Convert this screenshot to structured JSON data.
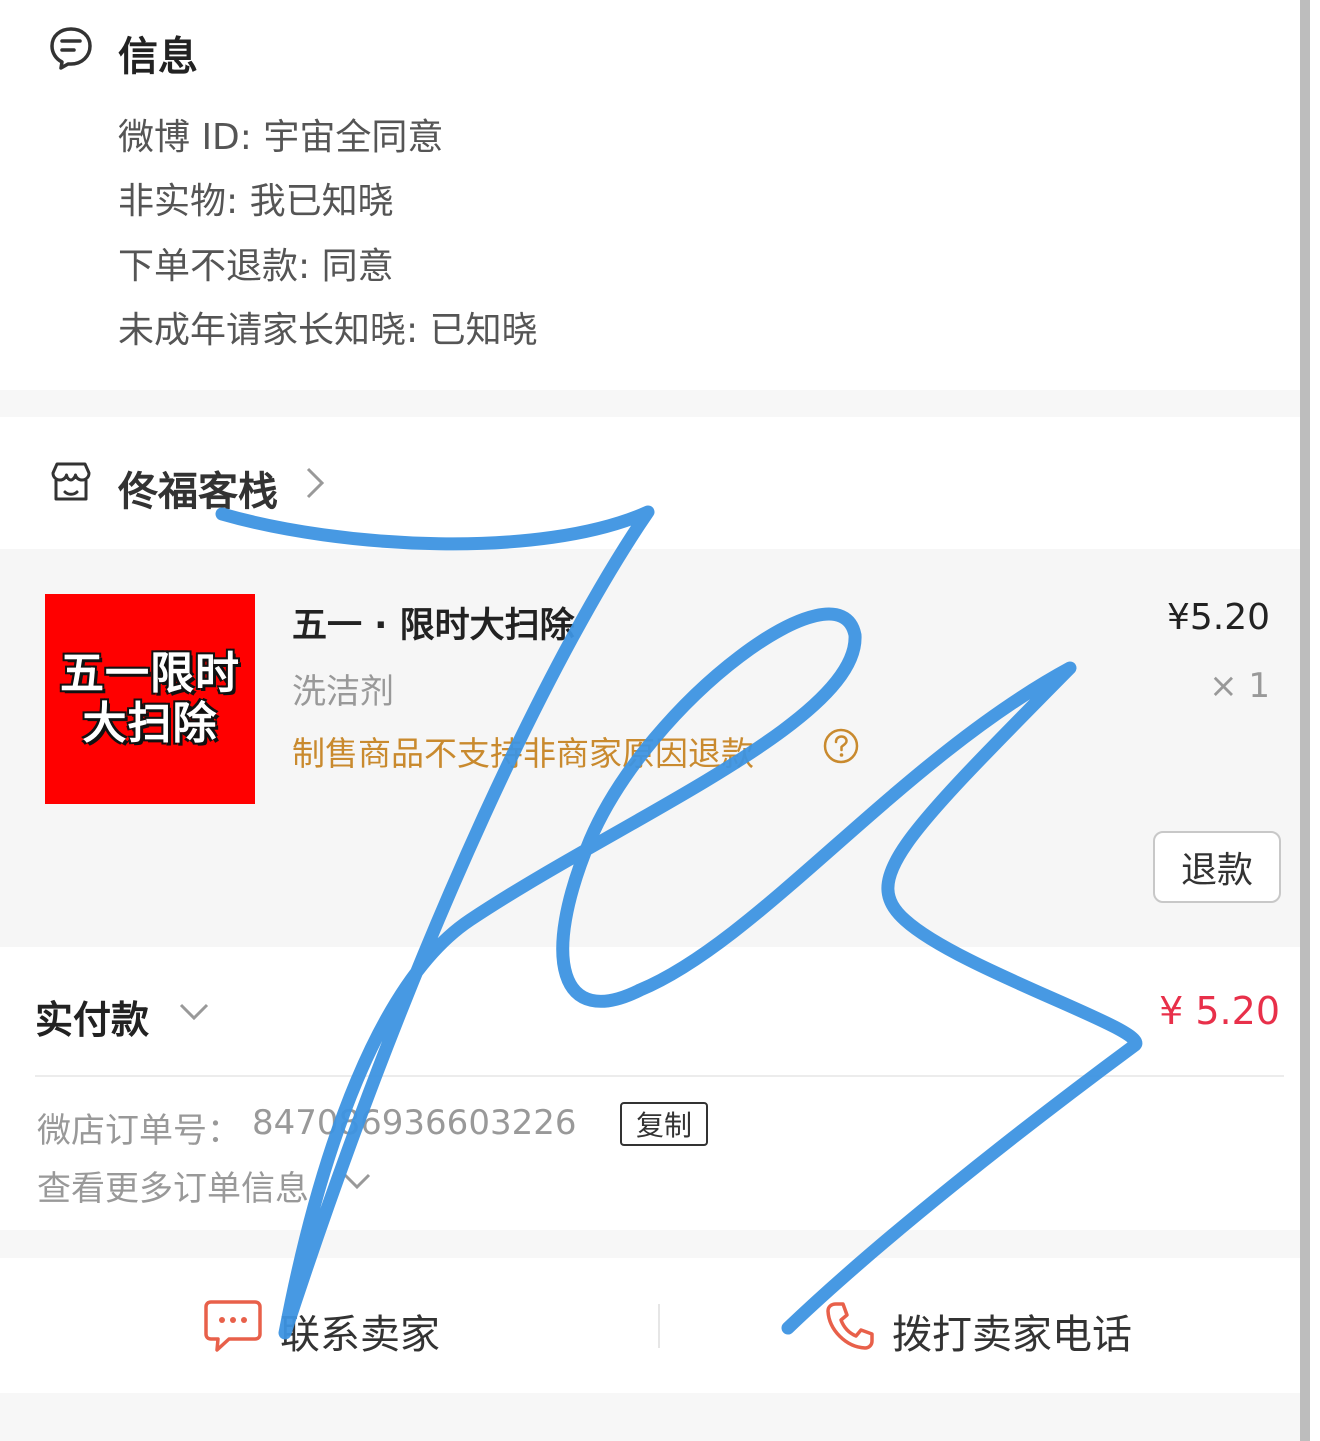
{
  "info": {
    "title": "信息",
    "rows": [
      "微博 ID: 宇宙全同意",
      "非实物: 我已知晓",
      "下单不退款: 同意",
      "未成年请家长知晓: 已知晓"
    ]
  },
  "shop": {
    "name": "佟福客栈"
  },
  "product": {
    "thumbnail_lines": [
      "五一限时",
      "大扫除"
    ],
    "title": "五一 · 限时大扫除",
    "spec": "洗洁剂",
    "notice": "制售商品不支持非商家原因退款",
    "price": "¥5.20",
    "quantity": "× 1",
    "refund_label": "退款"
  },
  "payment": {
    "label": "实付款",
    "amount": "¥ 5.20",
    "order_no_label": "微店订单号：",
    "order_no": "847086936603226",
    "copy_label": "复制",
    "more_label": "查看更多订单信息"
  },
  "actions": {
    "contact_seller": "联系卖家",
    "call_seller": "拨打卖家电话"
  },
  "colors": {
    "price_red": "#e8304a",
    "notice_orange": "#c98a2e",
    "signature_blue": "#3d94e2",
    "thumb_red": "#ff0000"
  },
  "icons": [
    "message-icon",
    "store-icon",
    "chevron-right-icon",
    "help-icon",
    "chevron-down-icon",
    "chat-bubble-icon",
    "phone-icon"
  ]
}
